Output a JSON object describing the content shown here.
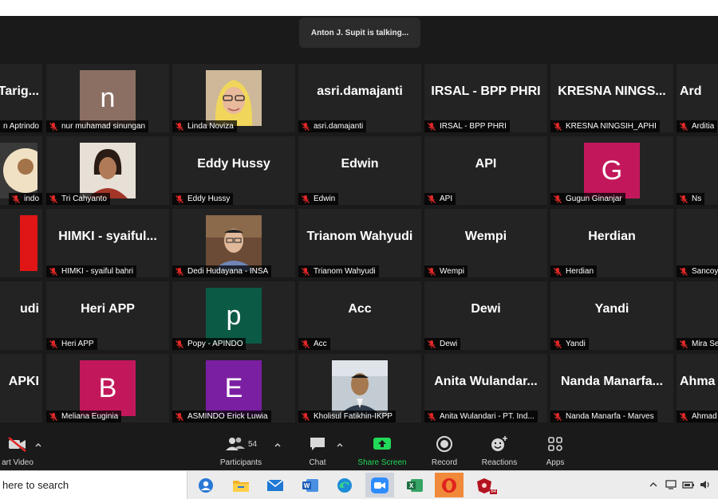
{
  "talking_indicator": "Anton J. Supit is talking...",
  "tiles": [
    {
      "id": "r1c0",
      "col": 0,
      "row": 0,
      "display": "name",
      "big": "Tarig...",
      "label": "n Aptrindo"
    },
    {
      "id": "r1c1",
      "col": 1,
      "row": 0,
      "display": "letter",
      "letter": "n",
      "color": "#8b6f62",
      "label": "nur muhamad sinungan"
    },
    {
      "id": "r1c2",
      "col": 2,
      "row": 0,
      "display": "photo",
      "photo": "woman-hijab",
      "label": "Linda Noviza"
    },
    {
      "id": "r1c3",
      "col": 3,
      "row": 0,
      "display": "name",
      "big": "asri.damajanti",
      "label": "asri.damajanti"
    },
    {
      "id": "r1c4",
      "col": 4,
      "row": 0,
      "display": "name",
      "big": "IRSAL - BPP PHRI",
      "label": "IRSAL - BPP PHRI"
    },
    {
      "id": "r1c5",
      "col": 5,
      "row": 0,
      "display": "name",
      "big": "KRESNA NINGS...",
      "label": "KRESNA NINGSIH_APHI"
    },
    {
      "id": "r1c6",
      "col": 6,
      "row": 0,
      "display": "name",
      "big": "Ard",
      "label": "Arditia"
    },
    {
      "id": "r2c0",
      "col": 0,
      "row": 1,
      "display": "photo",
      "photo": "partial-avatar",
      "label": "indo"
    },
    {
      "id": "r2c1",
      "col": 1,
      "row": 1,
      "display": "photo",
      "photo": "man-long-hair",
      "label": "Tri Cahyanto"
    },
    {
      "id": "r2c2",
      "col": 2,
      "row": 1,
      "display": "name",
      "big": "Eddy Hussy",
      "label": "Eddy Hussy"
    },
    {
      "id": "r2c3",
      "col": 3,
      "row": 1,
      "display": "name",
      "big": "Edwin",
      "label": "Edwin"
    },
    {
      "id": "r2c4",
      "col": 4,
      "row": 1,
      "display": "name",
      "big": "API",
      "label": "API"
    },
    {
      "id": "r2c5",
      "col": 5,
      "row": 1,
      "display": "letter",
      "letter": "G",
      "color": "#c2185b",
      "label": "Gugun Ginanjar"
    },
    {
      "id": "r2c6",
      "col": 6,
      "row": 1,
      "display": "empty",
      "label": "Ns"
    },
    {
      "id": "r3c0",
      "col": 0,
      "row": 2,
      "display": "photo",
      "photo": "red-block",
      "label": ""
    },
    {
      "id": "r3c1",
      "col": 1,
      "row": 2,
      "display": "name",
      "big": "HIMKI - syaiful...",
      "label": "HIMKI - syaiful bahri"
    },
    {
      "id": "r3c2",
      "col": 2,
      "row": 2,
      "display": "photo",
      "photo": "man-glasses",
      "label": "Dedi Hudayana - INSA"
    },
    {
      "id": "r3c3",
      "col": 3,
      "row": 2,
      "display": "name",
      "big": "Trianom Wahyudi",
      "label": "Trianom Wahyudi"
    },
    {
      "id": "r3c4",
      "col": 4,
      "row": 2,
      "display": "name",
      "big": "Wempi",
      "label": "Wempi"
    },
    {
      "id": "r3c5",
      "col": 5,
      "row": 2,
      "display": "name",
      "big": "Herdian",
      "label": "Herdian"
    },
    {
      "id": "r3c6",
      "col": 6,
      "row": 2,
      "display": "photo",
      "photo": "partial-dark",
      "label": "Sancoy"
    },
    {
      "id": "r4c0",
      "col": 0,
      "row": 3,
      "display": "name",
      "big": "udi",
      "label": ""
    },
    {
      "id": "r4c1",
      "col": 1,
      "row": 3,
      "display": "name",
      "big": "Heri APP",
      "label": "Heri APP"
    },
    {
      "id": "r4c2",
      "col": 2,
      "row": 3,
      "display": "letter",
      "letter": "p",
      "color": "#0b5a45",
      "label": "Popy - APINDO"
    },
    {
      "id": "r4c3",
      "col": 3,
      "row": 3,
      "display": "name",
      "big": "Acc",
      "label": "Acc"
    },
    {
      "id": "r4c4",
      "col": 4,
      "row": 3,
      "display": "name",
      "big": "Dewi",
      "label": "Dewi"
    },
    {
      "id": "r4c5",
      "col": 5,
      "row": 3,
      "display": "name",
      "big": "Yandi",
      "label": "Yandi"
    },
    {
      "id": "r4c6",
      "col": 6,
      "row": 3,
      "display": "photo",
      "photo": "partial-blue",
      "label": "Mira Se"
    },
    {
      "id": "r5c0",
      "col": 0,
      "row": 4,
      "display": "name",
      "big": "APKI",
      "label": ""
    },
    {
      "id": "r5c1",
      "col": 1,
      "row": 4,
      "display": "letter",
      "letter": "B",
      "color": "#c2185b",
      "label": "Meliana Euginia"
    },
    {
      "id": "r5c2",
      "col": 2,
      "row": 4,
      "display": "letter",
      "letter": "E",
      "color": "#7b1fa2",
      "label": "ASMINDO Erick Luwia"
    },
    {
      "id": "r5c3",
      "col": 3,
      "row": 4,
      "display": "photo",
      "photo": "man-office",
      "label": "Kholisul Fatikhin-IKPP"
    },
    {
      "id": "r5c4",
      "col": 4,
      "row": 4,
      "display": "name",
      "big": "Anita Wulandar...",
      "label": "Anita Wulandari - PT. Ind..."
    },
    {
      "id": "r5c5",
      "col": 5,
      "row": 4,
      "display": "name",
      "big": "Nanda Manarfa...",
      "label": "Nanda Manarfa - Marves"
    },
    {
      "id": "r5c6",
      "col": 6,
      "row": 4,
      "display": "name",
      "big": "Ahma",
      "label": "Ahmad"
    }
  ],
  "toolbar": {
    "start_video": "art Video",
    "participants": "Participants",
    "participants_count": "54",
    "chat": "Chat",
    "share_screen": "Share Screen",
    "record": "Record",
    "reactions": "Reactions",
    "apps": "Apps"
  },
  "taskbar": {
    "search_placeholder": "here to search",
    "apps": [
      "people-icon",
      "file-explorer-icon",
      "mail-icon",
      "word-icon",
      "edge-icon",
      "zoom-icon",
      "excel-icon",
      "opera-icon",
      "game-icon"
    ],
    "badge": "64"
  },
  "colors": {
    "share_green": "#23d959",
    "tile_bg": "#232323",
    "mute_red": "#e02828"
  }
}
